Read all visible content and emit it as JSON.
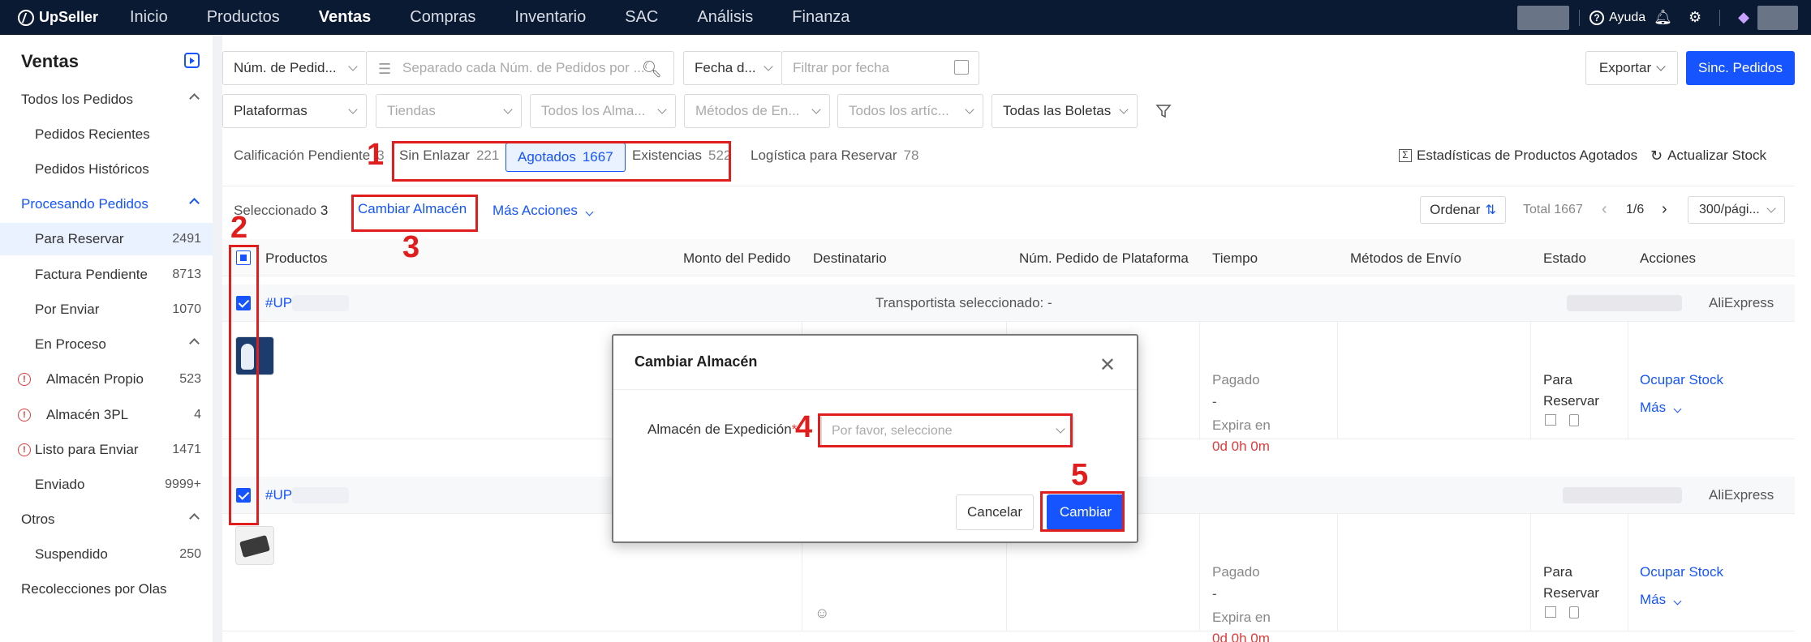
{
  "app": {
    "logo": "UpSeller"
  },
  "topnav": {
    "items": [
      "Inicio",
      "Productos",
      "Ventas",
      "Compras",
      "Inventario",
      "SAC",
      "Análisis",
      "Finanza"
    ],
    "active": "Ventas",
    "help": "Ayuda"
  },
  "sidebar": {
    "title": "Ventas",
    "all_orders": "Todos los Pedidos",
    "recent": "Pedidos Recientes",
    "historic": "Pedidos Históricos",
    "processing": "Procesando Pedidos",
    "to_reserve": {
      "label": "Para Reservar",
      "count": "2491"
    },
    "invoice_pending": {
      "label": "Factura Pendiente",
      "count": "8713"
    },
    "to_ship": {
      "label": "Por Enviar",
      "count": "1070"
    },
    "in_process": "En Proceso",
    "own_wh": {
      "label": "Almacén Propio",
      "count": "523"
    },
    "wh_3pl": {
      "label": "Almacén 3PL",
      "count": "4"
    },
    "ready": {
      "label": "Listo para Enviar",
      "count": "1471"
    },
    "sent": {
      "label": "Enviado",
      "count": "9999+"
    },
    "others": "Otros",
    "suspended": {
      "label": "Suspendido",
      "count": "250"
    },
    "waves": "Recolecciones por Olas"
  },
  "filters": {
    "order_num": "Núm. de Pedid...",
    "search_placeholder": "Separado cada Núm. de Pedidos por ...",
    "date_type": "Fecha d...",
    "date_placeholder": "Filtrar por fecha",
    "export": "Exportar",
    "sync": "Sinc. Pedidos",
    "platforms": "Plataformas",
    "stores": "Tiendas",
    "warehouses": "Todos los Alma...",
    "shipping_methods": "Métodos de En...",
    "items": "Todos los artíc...",
    "tickets": "Todas las Boletas"
  },
  "tabs": {
    "pending_rating": {
      "label": "Calificación Pendiente",
      "count": "3"
    },
    "unlinked": {
      "label": "Sin Enlazar",
      "count": "221"
    },
    "sold_out": {
      "label": "Agotados",
      "count": "1667"
    },
    "stock": {
      "label": "Existencias",
      "count": "522"
    },
    "logistics": {
      "label": "Logística para Reservar",
      "count": "78"
    },
    "stats": "Estadísticas de Productos Agotados",
    "update_stock": "Actualizar Stock"
  },
  "toolbar": {
    "selected_label": "Seleccionado",
    "selected_count": "3",
    "change_wh": "Cambiar Almacén",
    "more_actions": "Más Acciones",
    "sort": "Ordenar",
    "total": "Total 1667",
    "page": "1/6",
    "per_page": "300/pági..."
  },
  "table": {
    "headers": [
      "Productos",
      "Monto del Pedido",
      "Destinatario",
      "Núm. Pedido de Plataforma",
      "Tiempo",
      "Métodos de Envío",
      "Estado",
      "Acciones"
    ]
  },
  "orders": [
    {
      "id": "#UPH",
      "carrier": "Transportista seleccionado: -",
      "platform": "AliExpress",
      "paid": "Pagado",
      "dash": "-",
      "expires": "Expira en",
      "countdown": "0d 0h 0m",
      "status_1": "Para",
      "status_2": "Reservar",
      "action": "Ocupar Stock",
      "more": "Más"
    },
    {
      "id": "#UPH",
      "platform": "AliExpress",
      "paid": "Pagado",
      "dash": "-",
      "expires": "Expira en",
      "countdown": "0d 0h 0m",
      "status_1": "Para",
      "status_2": "Reservar",
      "action": "Ocupar Stock",
      "more": "Más"
    }
  ],
  "modal": {
    "title": "Cambiar Almacén",
    "label": "Almacén de Expedición",
    "required": "*",
    "placeholder": "Por favor, seleccione",
    "cancel": "Cancelar",
    "confirm": "Cambiar"
  },
  "annotations": [
    "1",
    "2",
    "3",
    "4",
    "5"
  ],
  "colors": {
    "accent": "#1654ff",
    "nav_bg": "#0b1a33",
    "annotation": "#e01e1e",
    "danger": "#e23b3b"
  }
}
